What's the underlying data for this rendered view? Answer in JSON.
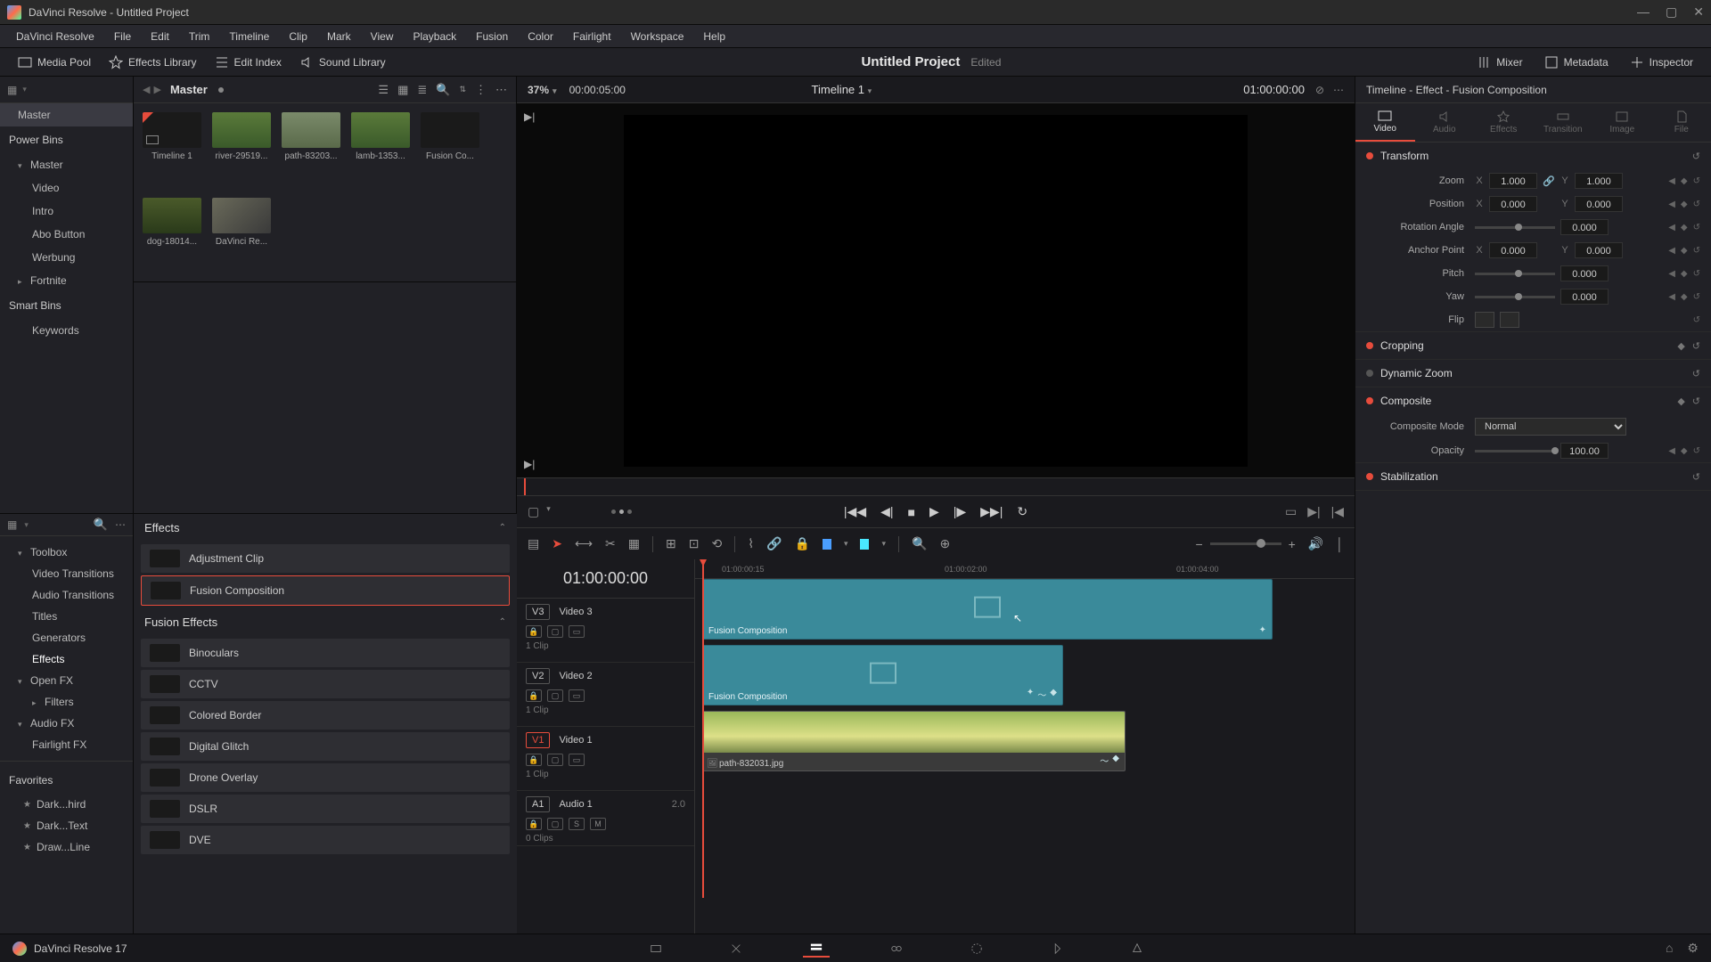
{
  "window": {
    "title": "DaVinci Resolve - Untitled Project"
  },
  "menu": [
    "DaVinci Resolve",
    "File",
    "Edit",
    "Trim",
    "Timeline",
    "Clip",
    "Mark",
    "View",
    "Playback",
    "Fusion",
    "Color",
    "Fairlight",
    "Workspace",
    "Help"
  ],
  "toolbar": {
    "media_pool": "Media Pool",
    "effects_library": "Effects Library",
    "edit_index": "Edit Index",
    "sound_library": "Sound Library",
    "project_name": "Untitled Project",
    "edited": "Edited",
    "mixer": "Mixer",
    "metadata": "Metadata",
    "inspector": "Inspector"
  },
  "media_bins": {
    "master": "Master",
    "power_bins": "Power Bins",
    "power_items": [
      "Master",
      "Video",
      "Intro",
      "Abo Button",
      "Werbung",
      "Fortnite"
    ],
    "smart_bins": "Smart Bins",
    "smart_items": [
      "Keywords"
    ]
  },
  "media_pool": {
    "path": "Master",
    "zoom_pct": "37%",
    "duration": "00:00:05:00",
    "timeline_name": "Timeline 1",
    "timecode": "01:00:00:00",
    "clips": [
      {
        "label": "Timeline 1",
        "kind": "timeline"
      },
      {
        "label": "river-29519...",
        "kind": "nature"
      },
      {
        "label": "path-83203...",
        "kind": "path"
      },
      {
        "label": "lamb-1353...",
        "kind": "nature"
      },
      {
        "label": "Fusion Co...",
        "kind": "fusion"
      },
      {
        "label": "dog-18014...",
        "kind": "dog"
      },
      {
        "label": "DaVinci Re...",
        "kind": "rail"
      }
    ]
  },
  "effects_tree": {
    "toolbox": "Toolbox",
    "toolbox_items": [
      "Video Transitions",
      "Audio Transitions",
      "Titles",
      "Generators",
      "Effects"
    ],
    "openfx": "Open FX",
    "openfx_items": [
      "Filters"
    ],
    "audiofx": "Audio FX",
    "audiofx_items": [
      "Fairlight FX"
    ],
    "favorites": "Favorites",
    "fav_items": [
      "Dark...hird",
      "Dark...Text",
      "Draw...Line"
    ]
  },
  "effects_list": {
    "effects_header": "Effects",
    "effects": [
      "Adjustment Clip",
      "Fusion Composition"
    ],
    "fusion_header": "Fusion Effects",
    "fusion": [
      "Binoculars",
      "CCTV",
      "Colored Border",
      "Digital Glitch",
      "Drone Overlay",
      "DSLR",
      "DVE"
    ]
  },
  "timeline": {
    "timecode": "01:00:00:00",
    "ruler_ticks": [
      "01:00:00:15",
      "01:00:02:00",
      "01:00:04:00"
    ],
    "tracks": [
      {
        "tag": "V3",
        "name": "Video 3",
        "clips": "1 Clip"
      },
      {
        "tag": "V2",
        "name": "Video 2",
        "clips": "1 Clip"
      },
      {
        "tag": "V1",
        "name": "Video 1",
        "clips": "1 Clip",
        "active": true
      },
      {
        "tag": "A1",
        "name": "Audio 1",
        "clips": "0 Clips",
        "ch": "2.0"
      }
    ],
    "clip_labels": {
      "fusion1": "Fusion Composition",
      "fusion2": "Fusion Composition",
      "file": "path-832031.jpg"
    }
  },
  "inspector": {
    "header": "Timeline - Effect - Fusion Composition",
    "tabs": [
      "Video",
      "Audio",
      "Effects",
      "Transition",
      "Image",
      "File"
    ],
    "transform": {
      "title": "Transform",
      "zoom_label": "Zoom",
      "zoom_x": "1.000",
      "zoom_y": "1.000",
      "position_label": "Position",
      "pos_x": "0.000",
      "pos_y": "0.000",
      "rotation_label": "Rotation Angle",
      "rotation": "0.000",
      "anchor_label": "Anchor Point",
      "anc_x": "0.000",
      "anc_y": "0.000",
      "pitch_label": "Pitch",
      "pitch": "0.000",
      "yaw_label": "Yaw",
      "yaw": "0.000",
      "flip_label": "Flip"
    },
    "cropping": "Cropping",
    "dynamic_zoom": "Dynamic Zoom",
    "composite": "Composite",
    "composite_mode_label": "Composite Mode",
    "composite_mode": "Normal",
    "opacity_label": "Opacity",
    "opacity": "100.00",
    "stabilization": "Stabilization"
  },
  "bottom": {
    "app_name": "DaVinci Resolve 17"
  }
}
